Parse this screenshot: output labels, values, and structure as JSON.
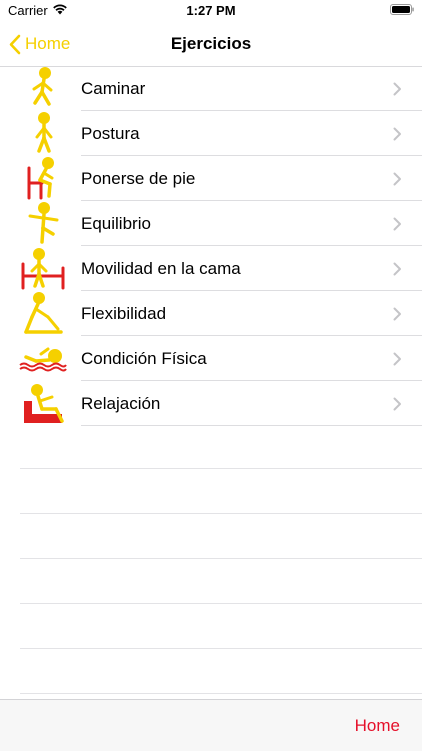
{
  "status": {
    "carrier": "Carrier",
    "time": "1:27 PM"
  },
  "nav": {
    "back_label": "Home",
    "title": "Ejercicios"
  },
  "items": [
    {
      "label": "Caminar",
      "icon": "walking-person-icon"
    },
    {
      "label": "Postura",
      "icon": "standing-person-icon"
    },
    {
      "label": "Ponerse de pie",
      "icon": "person-rising-from-chair-icon"
    },
    {
      "label": "Equilibrio",
      "icon": "balancing-person-icon"
    },
    {
      "label": "Movilidad en la cama",
      "icon": "person-in-bed-icon"
    },
    {
      "label": "Flexibilidad",
      "icon": "stretching-person-icon"
    },
    {
      "label": "Condición Física",
      "icon": "swimming-person-icon"
    },
    {
      "label": "Relajación",
      "icon": "person-in-armchair-icon"
    }
  ],
  "tabbar": {
    "home_label": "Home"
  },
  "colors": {
    "accent_yellow": "#F5D000",
    "tab_red": "#E5102A",
    "figure_red": "#E02020"
  }
}
